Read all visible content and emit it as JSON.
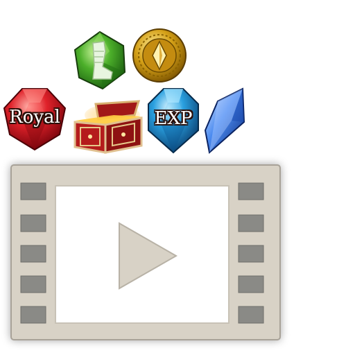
{
  "items": [
    {
      "id": "green-gem",
      "label": "",
      "icon": "boot-gem-icon",
      "color": "#4caf2a"
    },
    {
      "id": "gold-coin",
      "label": "",
      "icon": "gold-coin-icon",
      "color": "#d4a017"
    },
    {
      "id": "royal-gem",
      "label": "Royal",
      "icon": "royal-gem-icon",
      "color": "#c8141a"
    },
    {
      "id": "treasure-chest",
      "label": "",
      "icon": "treasure-chest-icon",
      "color": "#a11818"
    },
    {
      "id": "exp-gem",
      "label": "EXP",
      "icon": "exp-gem-icon",
      "color": "#2aa0e0"
    },
    {
      "id": "blue-crystal",
      "label": "",
      "icon": "blue-crystal-icon",
      "color": "#2f6fd8"
    }
  ],
  "video": {
    "icon": "video-play-icon",
    "frame_color": "#d8d2c6",
    "hole_color": "#8a8a86"
  }
}
